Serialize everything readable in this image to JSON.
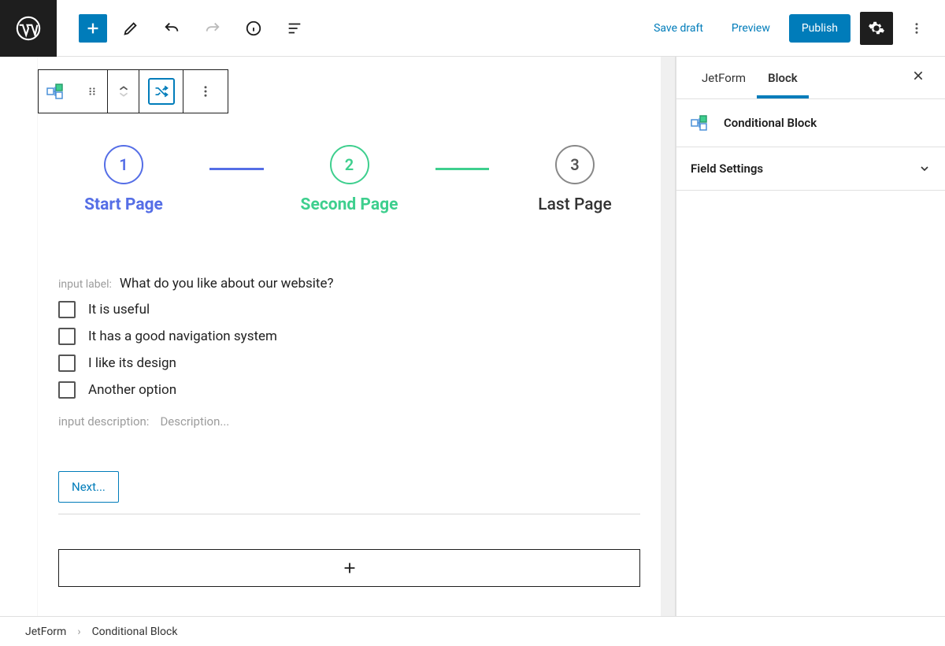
{
  "topbar": {
    "save_draft": "Save draft",
    "preview": "Preview",
    "publish": "Publish"
  },
  "steps": [
    {
      "num": "1",
      "label": "Start Page"
    },
    {
      "num": "2",
      "label": "Second Page"
    },
    {
      "num": "3",
      "label": "Last Page"
    }
  ],
  "form": {
    "label_hint": "input label:",
    "label_value": "What do you like about our website?",
    "options": [
      "It is useful",
      "It has a good navigation system",
      "I like its design",
      "Another option"
    ],
    "desc_hint": "input description:",
    "desc_value": "Description...",
    "next_label": "Next..."
  },
  "sidebar": {
    "tabs": {
      "jetform": "JetForm",
      "block": "Block"
    },
    "block_title": "Conditional Block",
    "panel1": "Field Settings"
  },
  "breadcrumb": {
    "root": "JetForm",
    "current": "Conditional Block"
  }
}
